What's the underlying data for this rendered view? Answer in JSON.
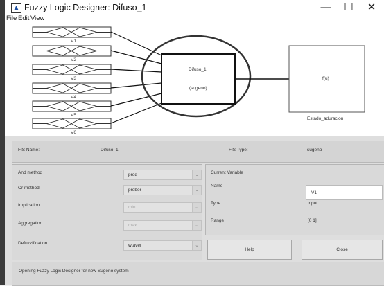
{
  "window": {
    "title": "Fuzzy Logic Designer: Difuso_1",
    "minimize": "—",
    "maximize": "☐",
    "close": "✕"
  },
  "menu": [
    "File",
    "Edit",
    "View"
  ],
  "diagram": {
    "inputs": [
      "V1",
      "V2",
      "V3",
      "V4",
      "V5",
      "V6"
    ],
    "fis_name": "Difuso_1",
    "fis_kind": "(sugeno)",
    "output_func": "f(u)",
    "output_name": "Estado_aduracion"
  },
  "fis_info": {
    "name_label": "FIS Name:",
    "name_value": "Difuso_1",
    "type_label": "FIS Type:",
    "type_value": "sugeno"
  },
  "methods": [
    {
      "label": "And method",
      "value": "prod",
      "enabled": true
    },
    {
      "label": "Or method",
      "value": "probor",
      "enabled": true
    },
    {
      "label": "Implication",
      "value": "min",
      "enabled": false
    },
    {
      "label": "Aggregation",
      "value": "max",
      "enabled": false
    },
    {
      "label": "Defuzzification",
      "value": "wtaver",
      "enabled": true
    }
  ],
  "current_variable": {
    "title": "Current Variable",
    "name_label": "Name",
    "name_value": "V1",
    "type_label": "Type",
    "type_value": "input",
    "range_label": "Range",
    "range_value": "[0 1]"
  },
  "buttons": {
    "help": "Help",
    "close": "Close"
  },
  "status": "Opening Fuzzy Logic Designer for new Sugeno system",
  "icons": {
    "app": "matlab-fuzzy-icon",
    "dropdown": "chevron-down-icon"
  }
}
